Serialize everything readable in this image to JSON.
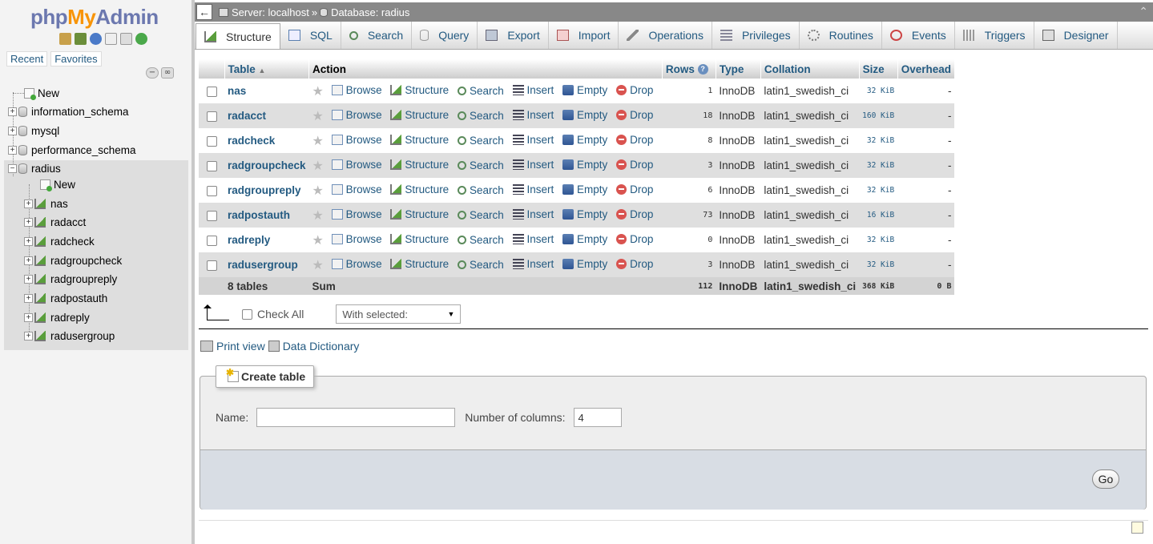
{
  "logo": {
    "php": "php",
    "my": "My",
    "admin": "Admin"
  },
  "nav": {
    "recent": "Recent",
    "favorites": "Favorites"
  },
  "tree": {
    "new": "New",
    "databases": [
      "information_schema",
      "mysql",
      "performance_schema",
      "radius"
    ],
    "radius_new": "New",
    "radius_tables": [
      "nas",
      "radacct",
      "radcheck",
      "radgroupcheck",
      "radgroupreply",
      "radpostauth",
      "radreply",
      "radusergroup"
    ]
  },
  "breadcrumb": {
    "server": "Server: localhost",
    "sep": "»",
    "database": "Database: radius"
  },
  "tabs": [
    "Structure",
    "SQL",
    "Search",
    "Query",
    "Export",
    "Import",
    "Operations",
    "Privileges",
    "Routines",
    "Events",
    "Triggers",
    "Designer"
  ],
  "table": {
    "headers": {
      "table": "Table",
      "action": "Action",
      "rows": "Rows",
      "type": "Type",
      "collation": "Collation",
      "size": "Size",
      "overhead": "Overhead"
    },
    "actions": {
      "browse": "Browse",
      "structure": "Structure",
      "search": "Search",
      "insert": "Insert",
      "empty": "Empty",
      "drop": "Drop"
    },
    "rows": [
      {
        "name": "nas",
        "rows": "1",
        "type": "InnoDB",
        "collation": "latin1_swedish_ci",
        "size": "32 KiB",
        "overhead": "-"
      },
      {
        "name": "radacct",
        "rows": "18",
        "type": "InnoDB",
        "collation": "latin1_swedish_ci",
        "size": "160 KiB",
        "overhead": "-"
      },
      {
        "name": "radcheck",
        "rows": "8",
        "type": "InnoDB",
        "collation": "latin1_swedish_ci",
        "size": "32 KiB",
        "overhead": "-"
      },
      {
        "name": "radgroupcheck",
        "rows": "3",
        "type": "InnoDB",
        "collation": "latin1_swedish_ci",
        "size": "32 KiB",
        "overhead": "-"
      },
      {
        "name": "radgroupreply",
        "rows": "6",
        "type": "InnoDB",
        "collation": "latin1_swedish_ci",
        "size": "32 KiB",
        "overhead": "-"
      },
      {
        "name": "radpostauth",
        "rows": "73",
        "type": "InnoDB",
        "collation": "latin1_swedish_ci",
        "size": "16 KiB",
        "overhead": "-"
      },
      {
        "name": "radreply",
        "rows": "0",
        "type": "InnoDB",
        "collation": "latin1_swedish_ci",
        "size": "32 KiB",
        "overhead": "-"
      },
      {
        "name": "radusergroup",
        "rows": "3",
        "type": "InnoDB",
        "collation": "latin1_swedish_ci",
        "size": "32 KiB",
        "overhead": "-"
      }
    ],
    "sum": {
      "label": "8 tables",
      "action": "Sum",
      "rows": "112",
      "type": "InnoDB",
      "collation": "latin1_swedish_ci",
      "size": "368 KiB",
      "overhead": "0 B"
    }
  },
  "bulk": {
    "check_all": "Check All",
    "with_selected": "With selected:"
  },
  "links": {
    "print_view": "Print view",
    "data_dictionary": "Data Dictionary"
  },
  "create": {
    "legend": "Create table",
    "name_label": "Name:",
    "name_value": "",
    "columns_label": "Number of columns:",
    "columns_value": "4",
    "go": "Go"
  },
  "colors": {
    "link": "#235a81",
    "topbar": "#888888",
    "row_even": "#dfdfdf"
  }
}
